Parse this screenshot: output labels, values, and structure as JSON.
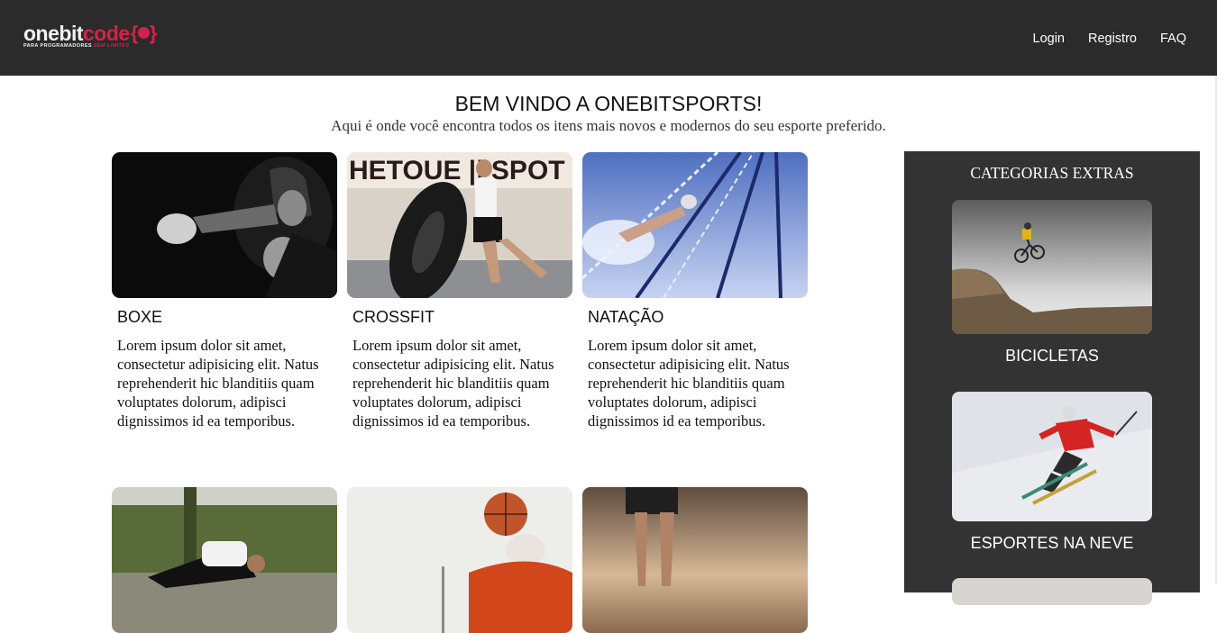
{
  "header": {
    "logo": {
      "text_main": "onebit",
      "text_accent": "code",
      "tagline_main": "PARA PROGRAMADORES",
      "tagline_accent": "SEM LIMITES",
      "icon": "rock-hand-icon"
    },
    "nav": [
      "Login",
      "Registro",
      "FAQ"
    ]
  },
  "hero": {
    "title": "BEM VINDO A ONEBITSPORTS!",
    "subtitle": "Aqui é onde você encontra todos os itens mais novos e modernos do seu esporte preferido."
  },
  "cards": [
    {
      "title": "BOXE",
      "text": "Lorem ipsum dolor sit amet, consectetur adipisicing elit. Natus reprehenderit hic blanditiis quam voluptates dolorum, adipisci dignissimos id ea temporibus."
    },
    {
      "title": "CROSSFIT",
      "text": "Lorem ipsum dolor sit amet, consectetur adipisicing elit. Natus reprehenderit hic blanditiis quam voluptates dolorum, adipisci dignissimos id ea temporibus."
    },
    {
      "title": "NATAÇÃO",
      "text": "Lorem ipsum dolor sit amet, consectetur adipisicing elit. Natus reprehenderit hic blanditiis quam voluptates dolorum, adipisci dignissimos id ea temporibus."
    }
  ],
  "sidebar": {
    "title": "CATEGORIAS EXTRAS",
    "items": [
      {
        "label": "BICICLETAS"
      },
      {
        "label": "ESPORTES NA NEVE"
      }
    ]
  },
  "colors": {
    "header_bg": "#2b2b2b",
    "sidebar_bg": "#333333",
    "brand_accent": "#d5214b"
  }
}
